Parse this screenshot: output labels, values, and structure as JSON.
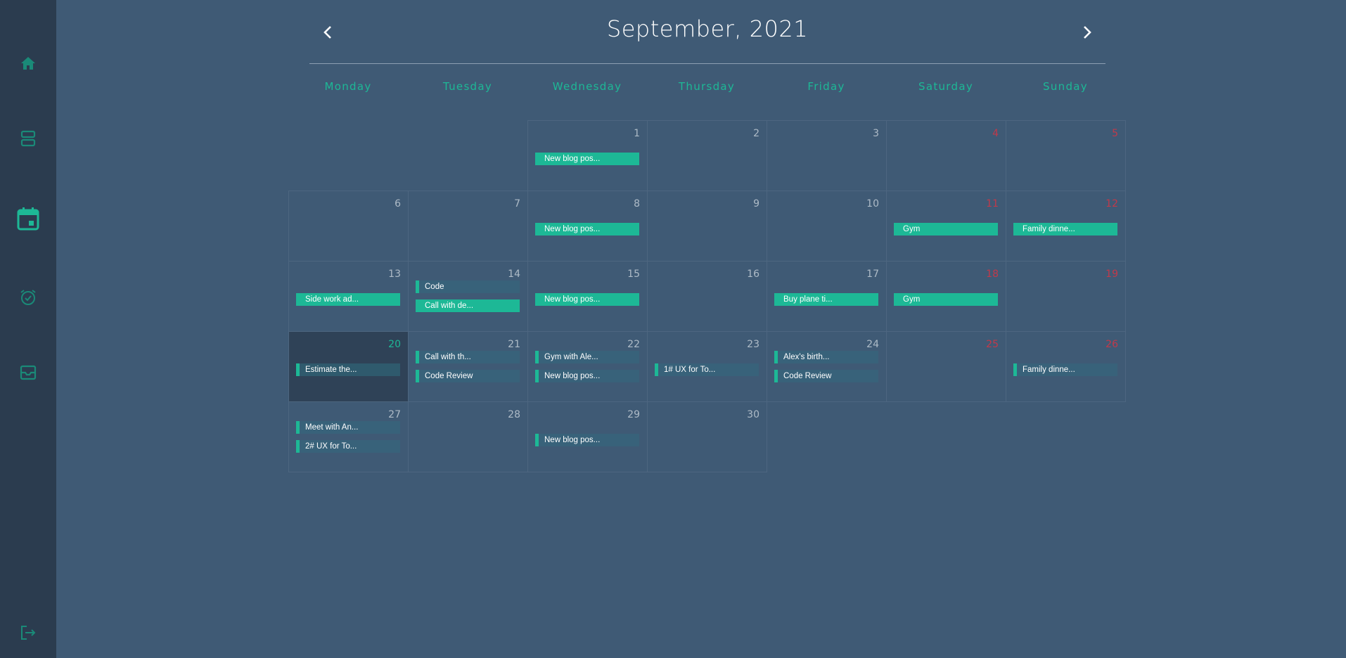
{
  "sidebar": {
    "icons": [
      "home-icon",
      "layout-icon",
      "calendar-icon",
      "alarm-icon",
      "inbox-icon",
      "logout-icon"
    ],
    "accent": "#1db896"
  },
  "header": {
    "title": "September, 2021",
    "prev": "chevron-left-icon",
    "next": "chevron-right-icon"
  },
  "weekdays": [
    "Monday",
    "Tuesday",
    "Wednesday",
    "Thursday",
    "Friday",
    "Saturday",
    "Sunday"
  ],
  "colors": {
    "background": "#3f5a75",
    "sidebar": "#2b3c4f",
    "accent": "#1db896",
    "weekend": "#c1394a",
    "today": "#2f4257"
  },
  "days": [
    {
      "day": "1",
      "events": [
        {
          "label": "New blog pos...",
          "style": "solid"
        }
      ]
    },
    {
      "day": "2",
      "events": []
    },
    {
      "day": "3",
      "events": []
    },
    {
      "day": "4",
      "weekend": true,
      "events": []
    },
    {
      "day": "5",
      "weekend": true,
      "events": []
    },
    {
      "day": "6",
      "events": []
    },
    {
      "day": "7",
      "events": []
    },
    {
      "day": "8",
      "events": [
        {
          "label": "New blog pos...",
          "style": "solid"
        }
      ]
    },
    {
      "day": "9",
      "events": []
    },
    {
      "day": "10",
      "events": []
    },
    {
      "day": "11",
      "weekend": true,
      "events": [
        {
          "label": "Gym",
          "style": "solid"
        }
      ]
    },
    {
      "day": "12",
      "weekend": true,
      "events": [
        {
          "label": "Family dinne...",
          "style": "solid"
        }
      ]
    },
    {
      "day": "13",
      "events": [
        {
          "label": "Side work ad...",
          "style": "solid"
        }
      ]
    },
    {
      "day": "14",
      "events": [
        {
          "label": "Code",
          "style": "muted"
        },
        {
          "label": "Call with de...",
          "style": "solid"
        }
      ]
    },
    {
      "day": "15",
      "events": [
        {
          "label": "New blog pos...",
          "style": "solid"
        }
      ]
    },
    {
      "day": "16",
      "events": []
    },
    {
      "day": "17",
      "events": [
        {
          "label": "Buy plane ti...",
          "style": "solid"
        }
      ]
    },
    {
      "day": "18",
      "weekend": true,
      "events": [
        {
          "label": "Gym",
          "style": "solid"
        }
      ]
    },
    {
      "day": "19",
      "weekend": true,
      "events": []
    },
    {
      "day": "20",
      "today": true,
      "events": [
        {
          "label": "Estimate the...",
          "style": "muted2"
        }
      ]
    },
    {
      "day": "21",
      "events": [
        {
          "label": "Call with th...",
          "style": "muted"
        },
        {
          "label": "Code Review",
          "style": "muted"
        }
      ]
    },
    {
      "day": "22",
      "events": [
        {
          "label": "Gym with Ale...",
          "style": "muted"
        },
        {
          "label": "New blog pos...",
          "style": "muted"
        }
      ]
    },
    {
      "day": "23",
      "events": [
        {
          "label": "1# UX for To...",
          "style": "muted"
        }
      ]
    },
    {
      "day": "24",
      "events": [
        {
          "label": "Alex's birth...",
          "style": "muted"
        },
        {
          "label": "Code Review",
          "style": "muted"
        }
      ]
    },
    {
      "day": "25",
      "weekend": true,
      "events": []
    },
    {
      "day": "26",
      "weekend": true,
      "events": [
        {
          "label": "Family dinne...",
          "style": "muted"
        }
      ]
    },
    {
      "day": "27",
      "events": [
        {
          "label": "Meet with An...",
          "style": "muted"
        },
        {
          "label": "2# UX for To...",
          "style": "muted"
        }
      ]
    },
    {
      "day": "28",
      "events": []
    },
    {
      "day": "29",
      "events": [
        {
          "label": "New blog pos...",
          "style": "muted"
        }
      ]
    },
    {
      "day": "30",
      "events": []
    }
  ]
}
